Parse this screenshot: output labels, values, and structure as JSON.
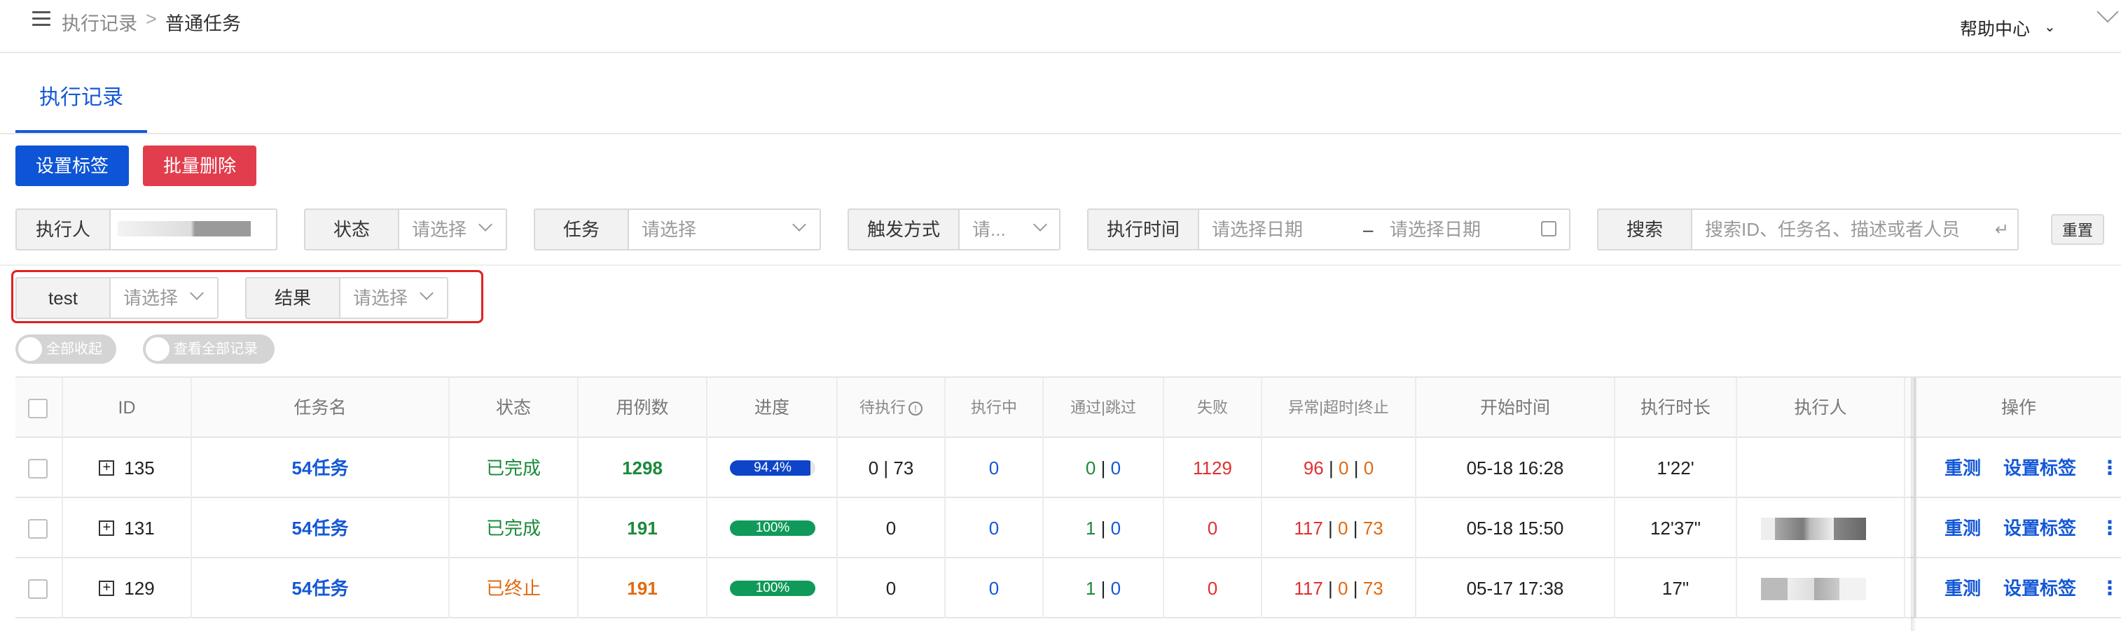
{
  "breadcrumb": {
    "parent": "执行记录",
    "separator": ">",
    "current": "普通任务"
  },
  "header": {
    "help_label": "帮助中心"
  },
  "tabs": [
    {
      "label": "执行记录",
      "active": true
    }
  ],
  "actions": {
    "set_tag": "设置标签",
    "batch_delete": "批量删除"
  },
  "filters": {
    "executor": {
      "label": "执行人"
    },
    "status": {
      "label": "状态",
      "placeholder": "请选择"
    },
    "task": {
      "label": "任务",
      "placeholder": "请选择"
    },
    "trigger": {
      "label": "触发方式",
      "placeholder": "请..."
    },
    "exec_time": {
      "label": "执行时间",
      "start_placeholder": "请选择日期",
      "separator": "–",
      "end_placeholder": "请选择日期"
    },
    "search": {
      "label": "搜索",
      "placeholder": "搜索ID、任务名、描述或者人员"
    },
    "reset": "重置",
    "test": {
      "label": "test",
      "placeholder": "请选择"
    },
    "result": {
      "label": "结果",
      "placeholder": "请选择"
    }
  },
  "toggles": {
    "collapse_all": "全部收起",
    "view_all": "查看全部记录"
  },
  "table": {
    "headers": {
      "id": "ID",
      "task_name": "任务名",
      "status": "状态",
      "case_count": "用例数",
      "progress": "进度",
      "pending": "待执行",
      "running": "执行中",
      "pass_skip": "通过|跳过",
      "fail": "失败",
      "error_timeout_stop": "异常|超时|终止",
      "start_time": "开始时间",
      "duration": "执行时长",
      "executor": "执行人",
      "operation": "操作"
    },
    "rows": [
      {
        "id": "135",
        "task_name": "54任务",
        "status": "已完成",
        "case_count": "1298",
        "progress": 0.944,
        "progress_label": "94.4%",
        "progress_color": "#0e45c8",
        "pending_a": "0",
        "pending_sep": "|",
        "pending_b": "73",
        "running": "0",
        "pass": "0",
        "pass_sep": "|",
        "skip": "0",
        "fail": "1129",
        "error": "96",
        "sep1": "|",
        "timeout": "0",
        "sep2": "|",
        "stop": "0",
        "start_time": "05-18 16:28",
        "duration": "1'22'",
        "op_retest": "重测",
        "op_set_tag": "设置标签",
        "op_more": "⋮"
      },
      {
        "id": "131",
        "task_name": "54任务",
        "status": "已完成",
        "case_count": "191",
        "progress": 1.0,
        "progress_label": "100%",
        "progress_color": "#0f9a5a",
        "pending_a": "0",
        "running": "0",
        "pass": "1",
        "pass_sep": "|",
        "skip": "0",
        "fail": "0",
        "error": "117",
        "sep1": "|",
        "timeout": "0",
        "sep2": "|",
        "stop": "73",
        "start_time": "05-18 15:50",
        "duration": "12'37\"",
        "op_retest": "重测",
        "op_set_tag": "设置标签",
        "op_more": "⋮"
      },
      {
        "id": "129",
        "task_name": "54任务",
        "status": "已终止",
        "case_count": "191",
        "progress": 1.0,
        "progress_label": "100%",
        "progress_color": "#0f9a5a",
        "pending_a": "0",
        "running": "0",
        "pass": "1",
        "pass_sep": "|",
        "skip": "0",
        "fail": "0",
        "error": "117",
        "sep1": "|",
        "timeout": "0",
        "sep2": "|",
        "stop": "73",
        "start_time": "05-17 17:38",
        "duration": "17\"",
        "op_retest": "重测",
        "op_set_tag": "设置标签",
        "op_more": "⋮"
      }
    ]
  }
}
